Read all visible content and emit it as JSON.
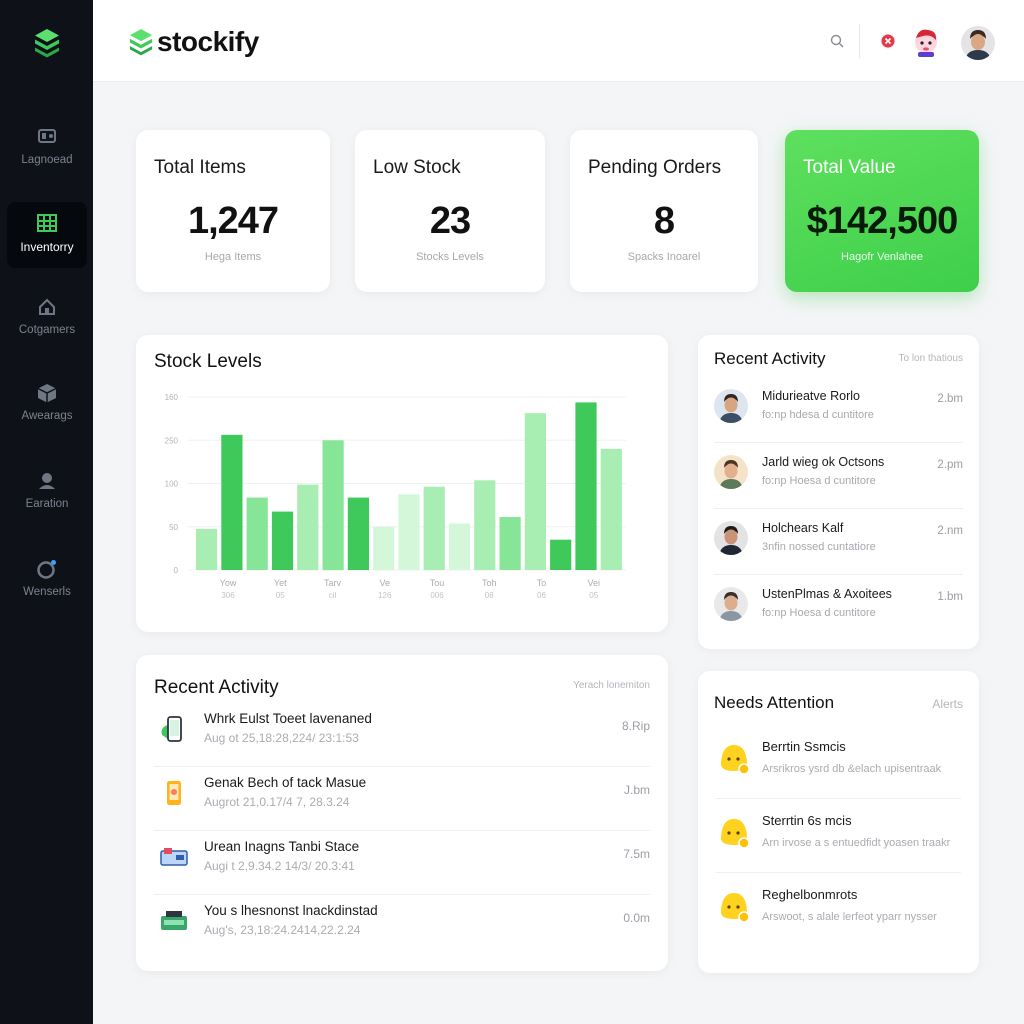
{
  "brand": {
    "name": "stockify",
    "accent": "#4cd964"
  },
  "sidebar": {
    "items": [
      {
        "label": "Lagnoead",
        "icon": "dashboard-icon",
        "active": false
      },
      {
        "label": "Inventorry",
        "icon": "inventory-grid-icon",
        "active": true
      },
      {
        "label": "Cotgamers",
        "icon": "categories-icon",
        "active": false
      },
      {
        "label": "Awearags",
        "icon": "box-icon",
        "active": false
      },
      {
        "label": "Earation",
        "icon": "user-icon",
        "active": false
      },
      {
        "label": "Wenserls",
        "icon": "settings-icon",
        "active": false
      }
    ]
  },
  "header": {
    "search_icon": "search-icon",
    "notification_icon": "close-badge-icon",
    "mascot_icon": "mascot-icon",
    "avatar_icon": "user-avatar"
  },
  "stats": [
    {
      "title": "Total Items",
      "value": "1,247",
      "sub": "Hega Items"
    },
    {
      "title": "Low Stock",
      "value": "23",
      "sub": "Stocks Levels"
    },
    {
      "title": "Pending Orders",
      "value": "8",
      "sub": "Spacks Inoarel"
    },
    {
      "title": "Total Value",
      "value": "$142,500",
      "sub": "Hagofr Venlahee"
    }
  ],
  "stock_panel": {
    "title": "Stock Levels"
  },
  "chart_data": {
    "type": "bar",
    "title": "Stock Levels",
    "ylim": [
      0,
      160
    ],
    "yticks": [
      "0",
      "50",
      "100",
      "250",
      "160"
    ],
    "xticks_top": [
      "Yow",
      "Yet",
      "Tarv",
      "Ve",
      "Tou",
      "Toh",
      "To",
      "Vei"
    ],
    "xticks_bottom": [
      "306",
      "05",
      "cil",
      "126",
      "006",
      "08",
      "06",
      "05"
    ],
    "values": [
      38,
      125,
      67,
      54,
      79,
      120,
      67,
      40,
      70,
      77,
      43,
      83,
      49,
      145,
      28,
      155,
      112
    ],
    "shades": [
      "light",
      "dark",
      "mid",
      "dark",
      "light",
      "mid",
      "dark",
      "pale",
      "pale",
      "light",
      "pale",
      "light",
      "mid",
      "light",
      "dark",
      "dark",
      "light"
    ],
    "colors": {
      "dark": "#3ec95a",
      "mid": "#86e596",
      "light": "#a8edb2",
      "pale": "#d4f6d9"
    }
  },
  "recent_activity_side": {
    "title": "Recent Activity",
    "hint": "To lon thatious",
    "items": [
      {
        "name": "Midurieatve Rorlo",
        "detail": "fo:np hdesa d cuntitore",
        "time": "2.bm"
      },
      {
        "name": "Jarld wieg ok Octsons",
        "detail": "fo:np Hoesa d cuntitore",
        "time": "2.pm"
      },
      {
        "name": "Holchears Kalf",
        "detail": "3nfin nossed cuntatiore",
        "time": "2.nm"
      },
      {
        "name": "UstenPlmas & Axoitees",
        "detail": "fo:np Hoesa d cuntitore",
        "time": "1.bm"
      }
    ]
  },
  "recent_activity_main": {
    "title": "Recent Activity",
    "hint": "Yerach lonemiton",
    "items": [
      {
        "name": "Whrk Eulst Toeet lavenaned",
        "date": "Aug ot 25,18:28,224/ 23:1:53",
        "size": "8.Rip",
        "icon": "phone-icon"
      },
      {
        "name": "Genak Bech of tack Masue",
        "date": "Augrot 21,0.17/4 7, 28.3.24",
        "size": "J.bm",
        "icon": "tablet-icon"
      },
      {
        "name": "Urean Inagns Tanbi Stace",
        "date": "Augi t 2,9.34.2 14/3/ 20.3:41",
        "size": "7.5m",
        "icon": "card-reader-icon"
      },
      {
        "name": "You s lhesnonst lnackdinstad",
        "date": "Aug's, 23,18:24.2414,22.2.24",
        "size": "0.0m",
        "icon": "scanner-icon"
      }
    ]
  },
  "needs_attention": {
    "title": "Needs Attention",
    "hint": "Alerts",
    "items": [
      {
        "name": "Berrtin Ssmcis",
        "detail": "Arsrikros ysrd db &elach upisentraak"
      },
      {
        "name": "Sterrtin 6s mcis",
        "detail": "Arn irvose a s entuedfidt yoasen traakr"
      },
      {
        "name": "Reghelbonmrots",
        "detail": "Arswoot, s alale lerfeot yparr nysser"
      }
    ]
  }
}
